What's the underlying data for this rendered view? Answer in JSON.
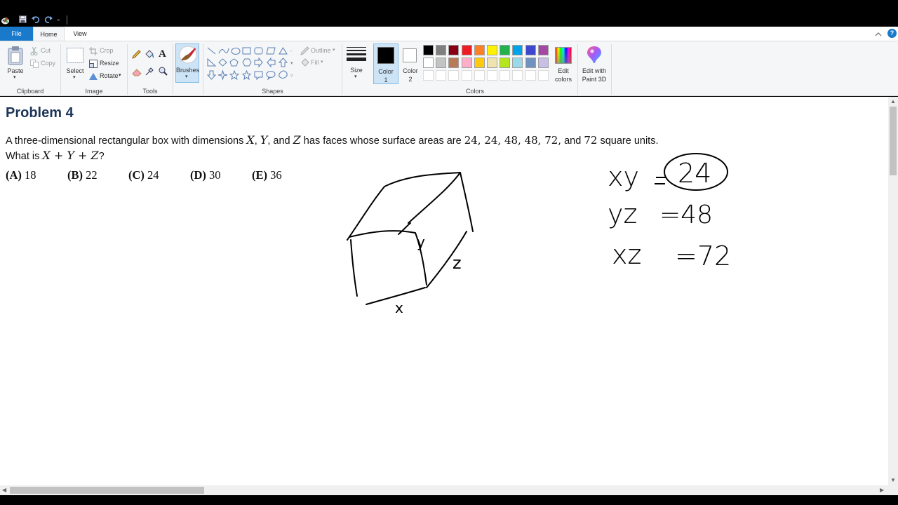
{
  "quick_access": {
    "icons": [
      "paint-app-icon",
      "save-icon",
      "undo-icon",
      "redo-icon",
      "customize-icon"
    ]
  },
  "tabs": [
    "File",
    "Home",
    "View"
  ],
  "ribbon": {
    "clipboard": {
      "paste": "Paste",
      "cut": "Cut",
      "copy": "Copy",
      "group": "Clipboard"
    },
    "image": {
      "select": "Select",
      "crop": "Crop",
      "resize": "Resize",
      "rotate": "Rotate",
      "group": "Image"
    },
    "tools": {
      "group": "Tools"
    },
    "brushes": {
      "label": "Brushes"
    },
    "shapes": {
      "outline": "Outline",
      "fill": "Fill",
      "group": "Shapes"
    },
    "size": {
      "label": "Size"
    },
    "color1": {
      "label_line1": "Color",
      "label_line2": "1"
    },
    "color2": {
      "label_line1": "Color",
      "label_line2": "2"
    },
    "colors": {
      "group": "Colors",
      "row1": [
        "#000000",
        "#7f7f7f",
        "#880015",
        "#ed1c24",
        "#ff7f27",
        "#fff200",
        "#22b14c",
        "#00a2e8",
        "#3f48cc",
        "#a349a4"
      ],
      "row2": [
        "#ffffff",
        "#c3c3c3",
        "#b97a57",
        "#ffaec9",
        "#ffc90e",
        "#efe4b0",
        "#b5e61d",
        "#99d9ea",
        "#7092be",
        "#c8bfe7"
      ]
    },
    "edit_colors": {
      "line1": "Edit",
      "line2": "colors"
    },
    "paint3d": {
      "line1": "Edit with",
      "line2": "Paint 3D"
    }
  },
  "canvas": {
    "title": "Problem 4",
    "line1_a": "A three-dimensional rectangular box with dimensions ",
    "var_x": "X",
    "comma1": ", ",
    "var_y": "Y",
    "line1_b": ", and ",
    "var_z": "Z",
    "line1_c": " has faces whose surface areas are ",
    "areas": "24, 24, 48, 48, 72,",
    "line1_d": " and ",
    "area_last": "72",
    "line1_e": " square units.",
    "line2_a": "What is ",
    "sum_expr": "X + Y + Z",
    "line2_b": "?",
    "choices": [
      {
        "letter": "(A)",
        "value": "18"
      },
      {
        "letter": "(B)",
        "value": "22"
      },
      {
        "letter": "(C)",
        "value": "24"
      },
      {
        "letter": "(D)",
        "value": "30"
      },
      {
        "letter": "(E)",
        "value": "36"
      }
    ],
    "handwriting": {
      "box_label_y": "y",
      "box_label_z": "z",
      "box_label_x": "x",
      "eq1_left": "xy",
      "eq1_right": "24",
      "eq2_left": "yz",
      "eq2_right": "=48",
      "eq3_left": "xz",
      "eq3_right": "=72"
    }
  }
}
